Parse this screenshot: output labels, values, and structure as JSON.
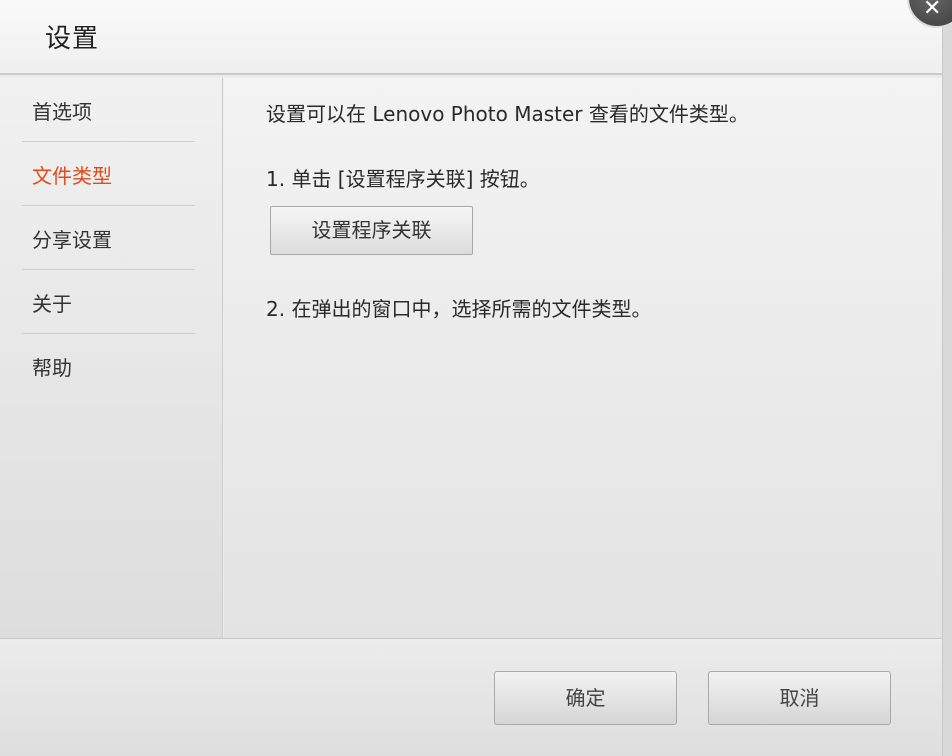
{
  "window": {
    "title": "设置",
    "close_icon_glyph": "✕"
  },
  "sidebar": {
    "items": [
      {
        "label": "首选项",
        "active": false
      },
      {
        "label": "文件类型",
        "active": true
      },
      {
        "label": "分享设置",
        "active": false
      },
      {
        "label": "关于",
        "active": false
      },
      {
        "label": "帮助",
        "active": false
      }
    ]
  },
  "main": {
    "intro": "设置可以在 Lenovo Photo Master 查看的文件类型。",
    "step1": "1. 单击 [设置程序关联] 按钮。",
    "assoc_button_label": "设置程序关联",
    "step2": "2. 在弹出的窗口中，选择所需的文件类型。"
  },
  "footer": {
    "ok_label": "确定",
    "cancel_label": "取消"
  },
  "colors": {
    "active_nav": "#e24a1a",
    "text": "#333333",
    "background": "#ececec"
  }
}
